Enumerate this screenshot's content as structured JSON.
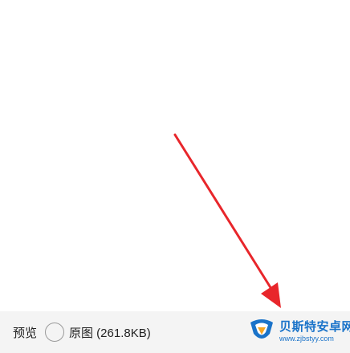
{
  "bottom_bar": {
    "preview_label": "预览",
    "original_label": "原图 (261.8KB)",
    "original_selected": false
  },
  "watermark": {
    "title": "贝斯特安卓网",
    "url": "www.zjbstyy.com"
  },
  "colors": {
    "arrow": "#e8262b",
    "bottom_bar_bg": "#f4f4f4",
    "watermark_blue": "#1a73c9"
  }
}
